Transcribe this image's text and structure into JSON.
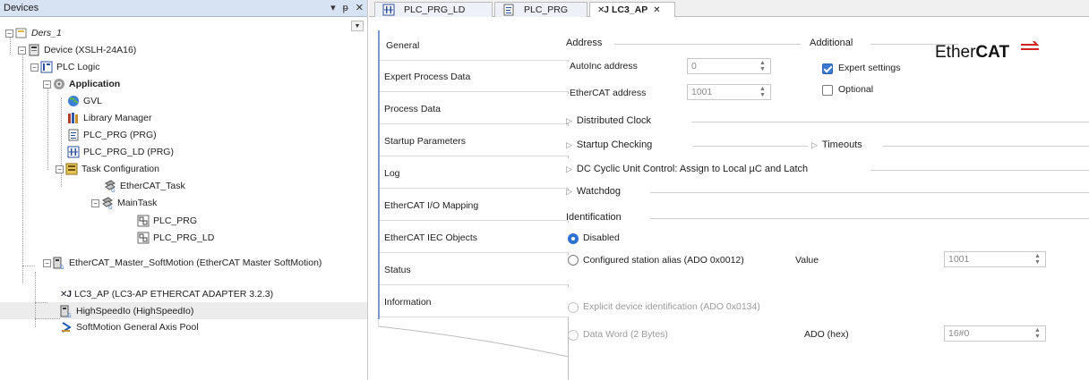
{
  "devices_pane": {
    "title": "Devices",
    "header_buttons": [
      "▾",
      "ᵽ",
      "✕"
    ]
  },
  "tree": {
    "root": "Ders_1",
    "device": "Device (XSLH-24A16)",
    "plc_logic": "PLC Logic",
    "application": "Application",
    "gvl": "GVL",
    "library_manager": "Library Manager",
    "plc_prg": "PLC_PRG (PRG)",
    "plc_prg_ld": "PLC_PRG_LD (PRG)",
    "task_configuration": "Task Configuration",
    "ethercat_task": "EtherCAT_Task",
    "main_task": "MainTask",
    "main_task_prg": "PLC_PRG",
    "main_task_prg_ld": "PLC_PRG_LD",
    "ethercat_master": "EtherCAT_Master_SoftMotion (EtherCAT Master SoftMotion)",
    "lc3_ap": "LC3_AP (LC3-AP ETHERCAT ADAPTER 3.2.3)",
    "high_speed_io": "HighSpeedIo (HighSpeedIo)",
    "softmotion_pool": "SoftMotion General Axis Pool"
  },
  "doc_tabs": [
    {
      "label": "PLC_PRG_LD",
      "icon": "ld-icon",
      "active": false
    },
    {
      "label": "PLC_PRG",
      "icon": "document-icon",
      "active": false
    },
    {
      "label": "LC3_AP",
      "icon": "xj-icon",
      "active": true,
      "close": "✕"
    }
  ],
  "side_tabs": [
    "General",
    "Expert Process Data",
    "Process Data",
    "Startup Parameters",
    "Log",
    "EtherCAT I/O Mapping",
    "EtherCAT IEC Objects",
    "Status",
    "Information"
  ],
  "general": {
    "address_title": "Address",
    "autoinc_label": "AutoInc address",
    "autoinc_value": "0",
    "ethercat_address_label": "EtherCAT address",
    "ethercat_address_value": "1001",
    "additional_title": "Additional",
    "expert_settings_label": "Expert settings",
    "expert_settings_checked": true,
    "optional_label": "Optional",
    "optional_checked": false,
    "logo_text_regular": "Ether",
    "logo_text_bold": "CAT",
    "distributed_clock": "Distributed Clock",
    "startup_checking": "Startup Checking",
    "timeouts": "Timeouts",
    "dc_cyclic": "DC Cyclic Unit Control: Assign to Local µC and Latch",
    "watchdog": "Watchdog",
    "identification_title": "Identification",
    "disabled_label": "Disabled",
    "configured_alias_label": "Configured station alias (ADO 0x0012)",
    "value_label": "Value",
    "value_value": "1001",
    "explicit_label": "Explicit device identification (ADO 0x0134)",
    "data_word_label": "Data Word (2 Bytes)",
    "ado_hex_label": "ADO (hex)",
    "ado_hex_value": "16#0"
  },
  "colors": {
    "header_bg": "#d7e3f2",
    "accent": "#2f6fd1",
    "ethercat_red": "#d3231f"
  }
}
